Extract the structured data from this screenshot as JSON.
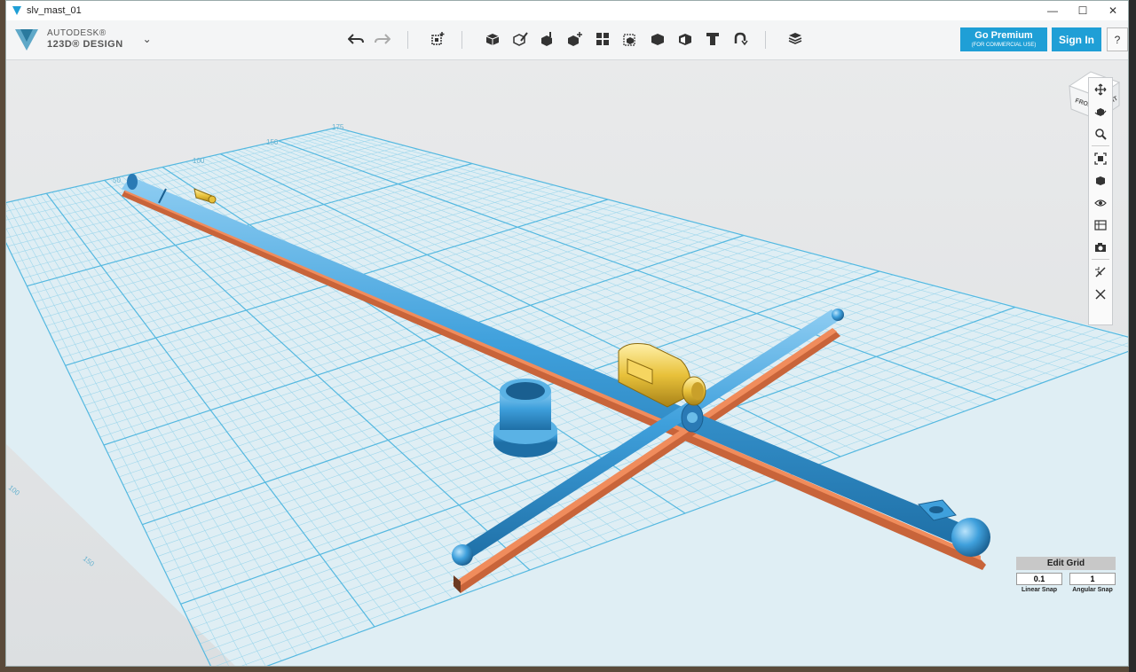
{
  "window": {
    "title": "slv_mast_01"
  },
  "logo": {
    "line1": "AUTODESK®",
    "line2": "123D® DESIGN"
  },
  "toolbar": {
    "tools": [
      {
        "name": "undo-icon"
      },
      {
        "name": "redo-icon"
      },
      {
        "name": "transform-icon"
      },
      {
        "name": "primitives-icon"
      },
      {
        "name": "sketch-icon"
      },
      {
        "name": "construct-icon"
      },
      {
        "name": "modify-icon"
      },
      {
        "name": "pattern-icon"
      },
      {
        "name": "group-icon"
      },
      {
        "name": "combine-icon"
      },
      {
        "name": "measure-icon"
      },
      {
        "name": "text-icon"
      },
      {
        "name": "snap-icon"
      },
      {
        "name": "material-icon"
      }
    ]
  },
  "header_buttons": {
    "premium_label": "Go Premium",
    "premium_sub": "(FOR COMMERCIAL USE)",
    "signin_label": "Sign In",
    "help_label": "?"
  },
  "viewcube": {
    "front": "FRONT",
    "right": "RIGHT"
  },
  "nav_tools": [
    "pan-icon",
    "orbit-icon",
    "zoom-icon",
    "fit-icon",
    "views-icon",
    "visibility-icon",
    "materials-outline-icon",
    "camera-icon",
    "grid-snap-icon",
    "hide-icon"
  ],
  "grid": {
    "title": "Edit Grid",
    "linear_value": "0.1",
    "angular_value": "1",
    "linear_label": "Linear Snap",
    "angular_label": "Angular Snap",
    "axis_labels": [
      "50",
      "100",
      "150",
      "175",
      "100",
      "150"
    ]
  },
  "colors": {
    "accent": "#1f9fd6",
    "part_blue": "#3fa0dc",
    "part_gold": "#e8c13a",
    "part_copper": "#c8643a",
    "grid_line": "#7ccbe8"
  }
}
